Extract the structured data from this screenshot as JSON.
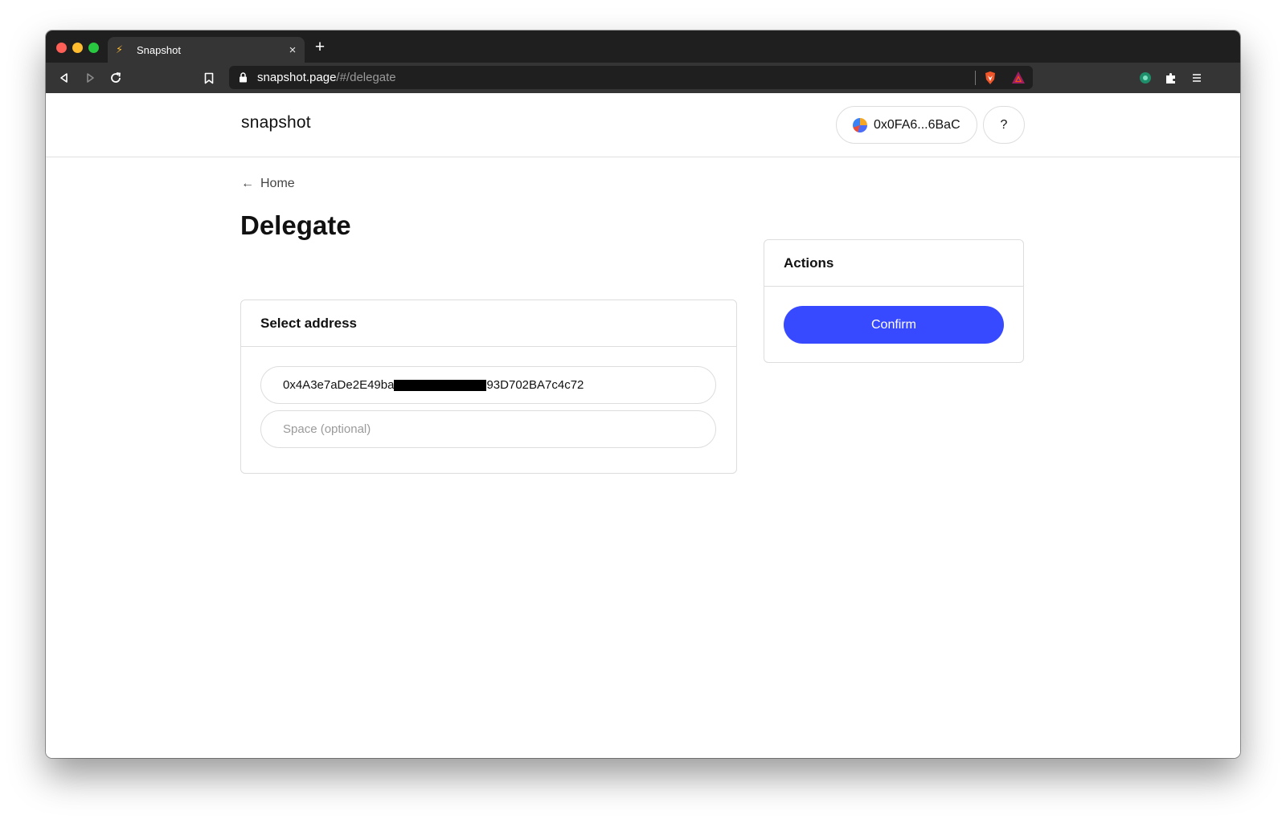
{
  "browser": {
    "tab_title": "Snapshot",
    "tab_favicon": "⚡",
    "tab_close": "×",
    "new_tab": "+",
    "url_host": "snapshot.page",
    "url_path": "/#/delegate",
    "icons": {
      "back": "back-arrow-icon",
      "forward": "forward-arrow-icon",
      "reload": "reload-icon",
      "bookmark": "bookmark-icon",
      "lock": "lock-icon",
      "shield": "brave-shield-icon",
      "rewards": "brave-rewards-icon",
      "extension": "extension-icon",
      "puzzle": "puzzle-icon",
      "menu": "menu-icon"
    }
  },
  "header": {
    "logo": "snapshot",
    "account": "0x0FA6...6BaC",
    "help": "?"
  },
  "nav": {
    "back_arrow": "←",
    "back_label": "Home"
  },
  "page": {
    "title": "Delegate"
  },
  "select_address": {
    "heading": "Select address",
    "address_value_start": "0x4A3e7aDe2E49ba",
    "address_value_end": "93D702BA7c4c72",
    "space_placeholder": "Space (optional)"
  },
  "actions": {
    "heading": "Actions",
    "confirm_label": "Confirm"
  },
  "colors": {
    "accent": "#384aff",
    "border": "#dddddd",
    "text": "#111111",
    "chrome_dark": "#1f1f1f",
    "chrome_mid": "#353535"
  }
}
